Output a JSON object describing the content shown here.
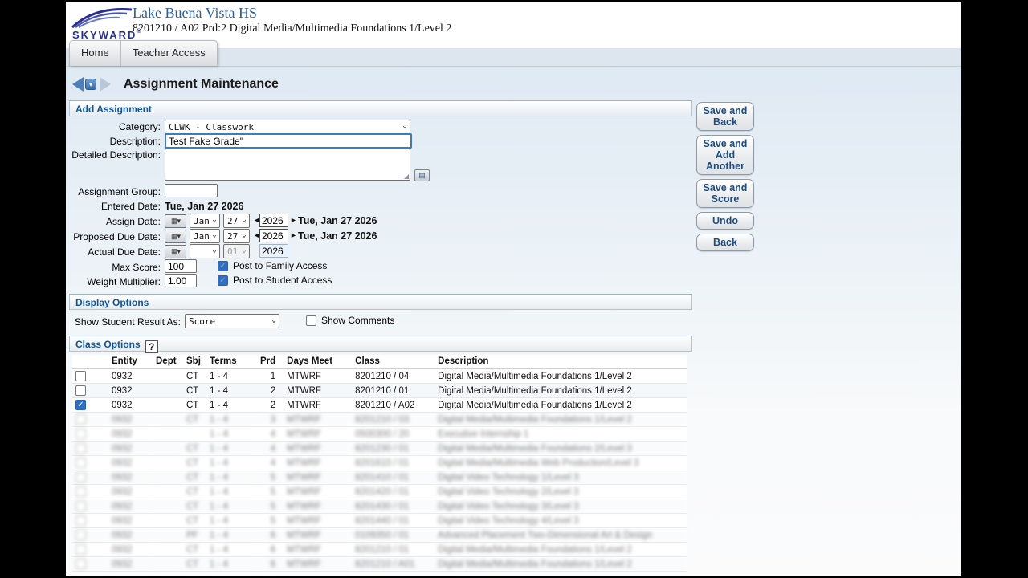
{
  "header": {
    "logo_text": "SKYWARD",
    "school_name": "Lake Buena Vista HS",
    "class_info": "8201210 / A02 Prd:2 Digital Media/Multimedia Foundations 1/Level 2"
  },
  "tabs": {
    "home": "Home",
    "teacher_access": "Teacher Access"
  },
  "page": {
    "title": "Assignment Maintenance"
  },
  "actions": {
    "save_and_back": "Save and Back",
    "save_and_add_another": "Save and Add Another",
    "save_and_score": "Save and Score",
    "undo": "Undo",
    "back": "Back"
  },
  "icons": {
    "dropdown_chevron": "⌄",
    "calendar": "▦▾",
    "nav_drop": "▾",
    "prev_year": "◄",
    "next_year": "►",
    "expand_editor": "▤",
    "resize_handle": "◢",
    "check": "✓"
  },
  "add_assignment": {
    "section_title": "Add Assignment",
    "category": {
      "label": "Category:",
      "value": "CLWK - Classwork"
    },
    "description": {
      "label": "Description:",
      "value": "Test Fake Grade\""
    },
    "detailed_description": {
      "label": "Detailed Description:",
      "value": ""
    },
    "assignment_group": {
      "label": "Assignment Group:",
      "value": ""
    },
    "entered_date": {
      "label": "Entered Date:",
      "value": "Tue, Jan 27 2026"
    },
    "assign_date": {
      "label": "Assign Date:",
      "month": "Jan",
      "day": "27",
      "year": "2026",
      "display": "Tue, Jan 27 2026"
    },
    "proposed_due_date": {
      "label": "Proposed Due Date:",
      "month": "Jan",
      "day": "27",
      "year": "2026",
      "display": "Tue, Jan 27 2026"
    },
    "actual_due_date": {
      "label": "Actual Due Date:",
      "month": "",
      "day": "01",
      "year": "2026"
    },
    "max_score": {
      "label": "Max Score:",
      "value": "100"
    },
    "weight_multiplier": {
      "label": "Weight Multiplier:",
      "value": "1.00"
    },
    "post_to_family": {
      "label": "Post to Family Access",
      "checked": true
    },
    "post_to_student": {
      "label": "Post to Student Access",
      "checked": true
    }
  },
  "display_options": {
    "section_title": "Display Options",
    "show_student_result_as": {
      "label": "Show Student Result As:",
      "value": "Score"
    },
    "show_comments": {
      "label": "Show Comments",
      "checked": false
    }
  },
  "class_options": {
    "section_title": "Class Options",
    "help_label": "?",
    "columns": {
      "entity": "Entity",
      "dept": "Dept",
      "sbj": "Sbj",
      "terms": "Terms",
      "prd": "Prd",
      "days": "Days Meet",
      "class": "Class",
      "description": "Description"
    },
    "rows": [
      {
        "checked": false,
        "blurred": false,
        "entity": "0932",
        "dept": "",
        "sbj": "CT",
        "terms": "1 - 4",
        "prd": "1",
        "days": "MTWRF",
        "class": "8201210 / 04",
        "description": "Digital Media/Multimedia Foundations 1/Level 2"
      },
      {
        "checked": false,
        "blurred": false,
        "entity": "0932",
        "dept": "",
        "sbj": "CT",
        "terms": "1 - 4",
        "prd": "2",
        "days": "MTWRF",
        "class": "8201210 / 01",
        "description": "Digital Media/Multimedia Foundations 1/Level 2"
      },
      {
        "checked": true,
        "blurred": false,
        "entity": "0932",
        "dept": "",
        "sbj": "CT",
        "terms": "1 - 4",
        "prd": "2",
        "days": "MTWRF",
        "class": "8201210 / A02",
        "description": "Digital Media/Multimedia Foundations 1/Level 2"
      },
      {
        "checked": false,
        "blurred": true,
        "entity": "0932",
        "dept": "",
        "sbj": "CT",
        "terms": "1 - 4",
        "prd": "3",
        "days": "MTWRF",
        "class": "8201210 / 03",
        "description": "Digital Media/Multimedia Foundations 1/Level 2"
      },
      {
        "checked": false,
        "blurred": true,
        "entity": "0932",
        "dept": "",
        "sbj": "",
        "terms": "1 - 4",
        "prd": "4",
        "days": "MTWRF",
        "class": "0500300 / 20",
        "description": "Executive Internship 1"
      },
      {
        "checked": false,
        "blurred": true,
        "entity": "0932",
        "dept": "",
        "sbj": "CT",
        "terms": "1 - 4",
        "prd": "4",
        "days": "MTWRF",
        "class": "8201230 / 01",
        "description": "Digital Media/Multimedia Foundations 2/Level 3"
      },
      {
        "checked": false,
        "blurred": true,
        "entity": "0932",
        "dept": "",
        "sbj": "CT",
        "terms": "1 - 4",
        "prd": "4",
        "days": "MTWRF",
        "class": "8201610 / 01",
        "description": "Digital Media/Multimedia Web Production/Level 3"
      },
      {
        "checked": false,
        "blurred": true,
        "entity": "0932",
        "dept": "",
        "sbj": "CT",
        "terms": "1 - 4",
        "prd": "5",
        "days": "MTWRF",
        "class": "8201410 / 01",
        "description": "Digital Video Technology 1/Level 3"
      },
      {
        "checked": false,
        "blurred": true,
        "entity": "0932",
        "dept": "",
        "sbj": "CT",
        "terms": "1 - 4",
        "prd": "5",
        "days": "MTWRF",
        "class": "8201420 / 01",
        "description": "Digital Video Technology 2/Level 3"
      },
      {
        "checked": false,
        "blurred": true,
        "entity": "0932",
        "dept": "",
        "sbj": "CT",
        "terms": "1 - 4",
        "prd": "5",
        "days": "MTWRF",
        "class": "8201430 / 01",
        "description": "Digital Video Technology 3/Level 3"
      },
      {
        "checked": false,
        "blurred": true,
        "entity": "0932",
        "dept": "",
        "sbj": "CT",
        "terms": "1 - 4",
        "prd": "5",
        "days": "MTWRF",
        "class": "8201440 / 01",
        "description": "Digital Video Technology 4/Level 3"
      },
      {
        "checked": false,
        "blurred": true,
        "entity": "0932",
        "dept": "",
        "sbj": "PF",
        "terms": "1 - 4",
        "prd": "6",
        "days": "MTWRF",
        "class": "0109350 / 01",
        "description": "Advanced Placement Two-Dimensional Art & Design"
      },
      {
        "checked": false,
        "blurred": true,
        "entity": "0932",
        "dept": "",
        "sbj": "CT",
        "terms": "1 - 4",
        "prd": "6",
        "days": "MTWRF",
        "class": "8201210 / 01",
        "description": "Digital Media/Multimedia Foundations 1/Level 2"
      },
      {
        "checked": false,
        "blurred": true,
        "entity": "0932",
        "dept": "",
        "sbj": "CT",
        "terms": "1 - 4",
        "prd": "6",
        "days": "MTWRF",
        "class": "8201210 / A01",
        "description": "Digital Media/Multimedia Foundations 1/Level 2"
      }
    ]
  }
}
